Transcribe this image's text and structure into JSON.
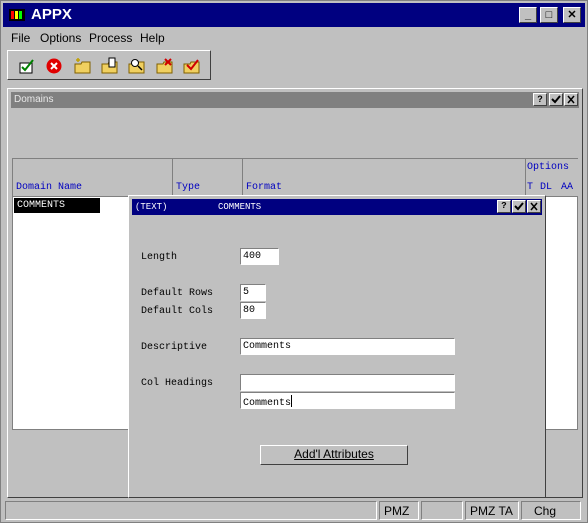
{
  "app": {
    "title": "APPX"
  },
  "titlebar": {
    "min_label": "_",
    "max_label": "□",
    "close_label": "✕"
  },
  "menu": {
    "items": [
      {
        "label": "File"
      },
      {
        "label": "Options"
      },
      {
        "label": "Process"
      },
      {
        "label": "Help"
      }
    ]
  },
  "toolbar": {
    "icons": [
      "ok-check-icon",
      "cancel-icon",
      "new-folder-icon",
      "folder-edit-icon",
      "folder-search-icon",
      "folder-delete-icon",
      "folder-copy-icon"
    ]
  },
  "domains": {
    "title": "Domains",
    "help_label": "?",
    "columns": {
      "domain_name": "Domain Name",
      "type": "Type",
      "format": "Format",
      "options": "Options",
      "opt_t": "T",
      "opt_dl": "DL",
      "opt_aa": "AA"
    },
    "rows": [
      {
        "name": "COMMENTS"
      }
    ]
  },
  "dialog": {
    "title_left": "(TEXT)",
    "title_right": "COMMENTS",
    "help_label": "?",
    "fields": {
      "length_label": "Length",
      "length_value": "400",
      "rows_label": "Default Rows",
      "rows_value": "5",
      "cols_label": "Default Cols",
      "cols_value": "80",
      "descriptive_label": "Descriptive",
      "descriptive_value": "Comments",
      "colhead_label": "Col Headings",
      "colhead_value1": "",
      "colhead_value2": "Comments"
    },
    "addl_button": "Add'l Attributes"
  },
  "status": {
    "s1": "PMZ",
    "s2": "PMZ TA",
    "s3": "Chg"
  },
  "colors": {
    "title_bar": "#000080",
    "panel_bar": "#808080",
    "header_text": "#0000c0"
  }
}
